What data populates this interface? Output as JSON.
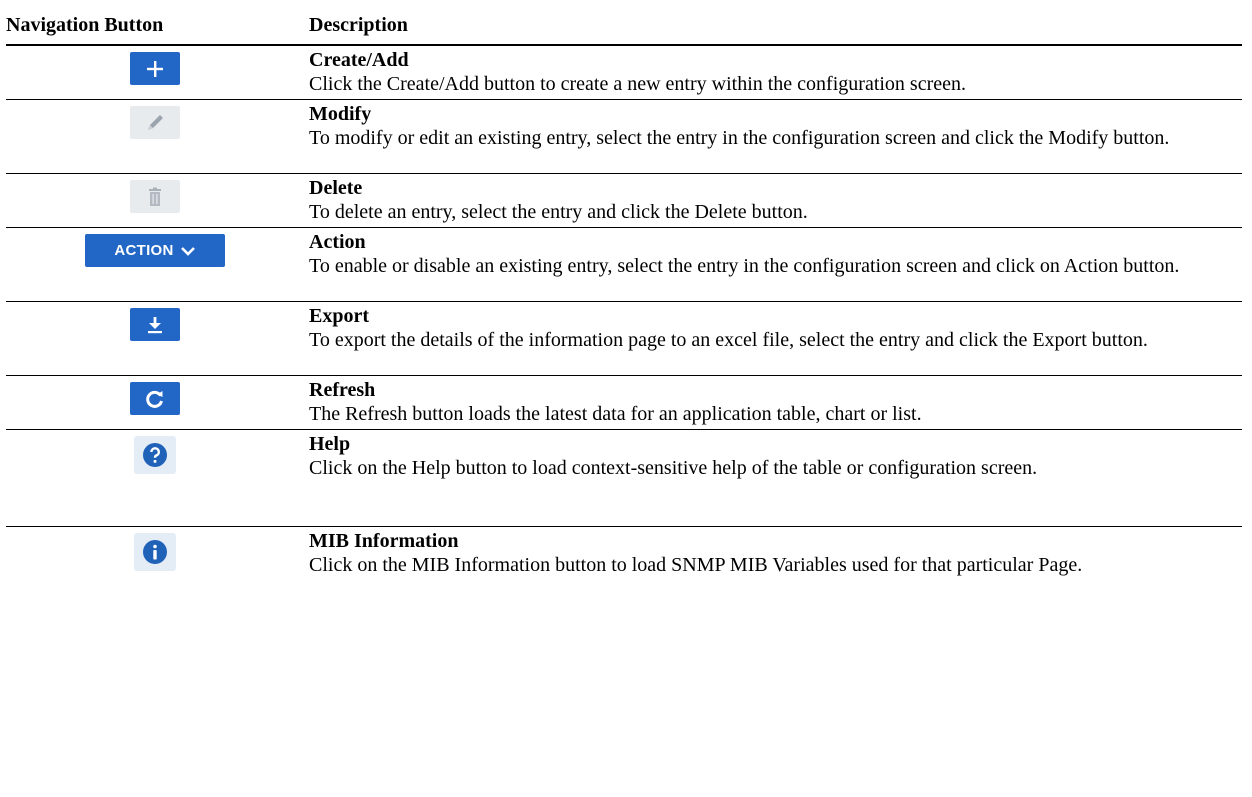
{
  "header": {
    "col1": "Navigation Button",
    "col2": "Description"
  },
  "rows": [
    {
      "icon": "plus-icon",
      "title": "Create/Add",
      "desc": "Click the Create/Add button to create a new entry within the configuration screen."
    },
    {
      "icon": "pencil-icon",
      "title": "Modify",
      "desc": "To modify or edit an existing entry, select the entry in the configuration screen and click the Modify button."
    },
    {
      "icon": "trash-icon",
      "title": "Delete",
      "desc": "To delete an entry, select the entry and click the Delete button."
    },
    {
      "icon": "chevron-down-icon",
      "title": "Action",
      "button_label": "ACTION",
      "desc": "To enable or disable an existing entry, select the entry in the configuration screen and click on Action button."
    },
    {
      "icon": "download-icon",
      "title": "Export",
      "desc": "To export the details of the information page to an excel file, select the entry and click the Export button."
    },
    {
      "icon": "refresh-icon",
      "title": "Refresh",
      "desc": "The Refresh button loads the latest data for an application table, chart or list."
    },
    {
      "icon": "help-icon",
      "title": "Help",
      "desc": "Click on the Help button to load context-sensitive help of the table or configuration screen."
    },
    {
      "icon": "info-icon",
      "title": "MIB Information",
      "desc": "Click on the MIB Information button to load SNMP MIB Variables used for that particular Page."
    }
  ],
  "colors": {
    "button_blue": "#2266c6",
    "button_gray": "#e8ebee",
    "circle_blue": "#1f62b8"
  }
}
